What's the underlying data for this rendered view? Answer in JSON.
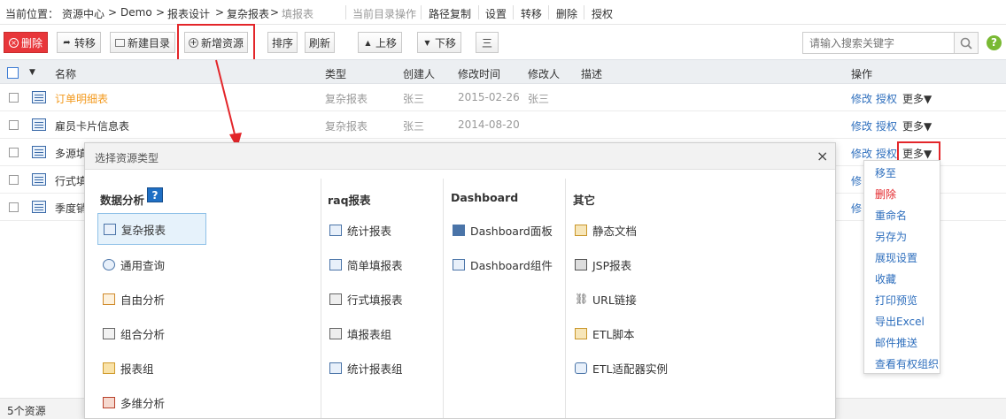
{
  "breadcrumb": {
    "label": "当前位置：",
    "items": [
      "资源中心",
      "Demo",
      "报表设计",
      "复杂报表",
      "填报表"
    ],
    "sep": ">"
  },
  "dir_ops": {
    "label": "当前目录操作",
    "items": [
      "路径复制",
      "设置",
      "转移",
      "删除",
      "授权"
    ]
  },
  "toolbar": {
    "delete": "删除",
    "transfer": "转移",
    "new_dir": "新建目录",
    "new_resource": "新增资源",
    "sort": "排序",
    "refresh": "刷新",
    "up": "上移",
    "down": "下移",
    "view": "三"
  },
  "search": {
    "placeholder": "请输入搜索关键字"
  },
  "table": {
    "headers": [
      "名称",
      "类型",
      "创建人",
      "修改时间",
      "修改人",
      "描述",
      "操作"
    ],
    "rows": [
      {
        "name": "订单明细表",
        "type": "复杂报表",
        "creator": "张三",
        "mtime": "2015-02-26",
        "modifier": "张三",
        "desc": "",
        "ops": [
          "修改",
          "授权",
          "更多▼"
        ]
      },
      {
        "name": "雇员卡片信息表",
        "type": "复杂报表",
        "creator": "张三",
        "mtime": "2014-08-20",
        "modifier": "",
        "desc": "",
        "ops": [
          "修改",
          "授权",
          "更多▼"
        ]
      },
      {
        "name": "多源填",
        "type": "",
        "creator": "",
        "mtime": "",
        "modifier": "",
        "desc": "",
        "ops": [
          "修改",
          "授权",
          "更多▼"
        ]
      },
      {
        "name": "行式填",
        "type": "",
        "creator": "",
        "mtime": "",
        "modifier": "",
        "desc": "",
        "ops": [
          "修"
        ]
      },
      {
        "name": "季度销",
        "type": "",
        "creator": "",
        "mtime": "",
        "modifier": "",
        "desc": "",
        "ops": [
          "修"
        ]
      }
    ]
  },
  "footer": {
    "count": "5个资源"
  },
  "dialog": {
    "title": "选择资源类型",
    "close": "×",
    "columns": [
      {
        "title": "数据分析",
        "help": "?",
        "items": [
          "复杂报表",
          "通用查询",
          "自由分析",
          "组合分析",
          "报表组",
          "多维分析"
        ]
      },
      {
        "title": "raq报表",
        "items": [
          "统计报表",
          "简单填报表",
          "行式填报表",
          "填报表组",
          "统计报表组"
        ]
      },
      {
        "title": "Dashboard",
        "items": [
          "Dashboard面板",
          "Dashboard组件"
        ]
      },
      {
        "title": "其它",
        "items": [
          "静态文档",
          "JSP报表",
          "URL链接",
          "ETL脚本",
          "ETL适配器实例"
        ]
      }
    ]
  },
  "more_menu": {
    "items": [
      "移至",
      "删除",
      "重命名",
      "另存为",
      "展现设置",
      "收藏",
      "打印预览",
      "导出Excel",
      "邮件推送",
      "查看有权组织"
    ]
  },
  "colors": {
    "orange": "#f39a1e",
    "link": "#2d6ebd",
    "red": "#e3262a",
    "delete_btn": "#e8363a",
    "help": "#1f6fc4",
    "ok": "#79b933"
  }
}
